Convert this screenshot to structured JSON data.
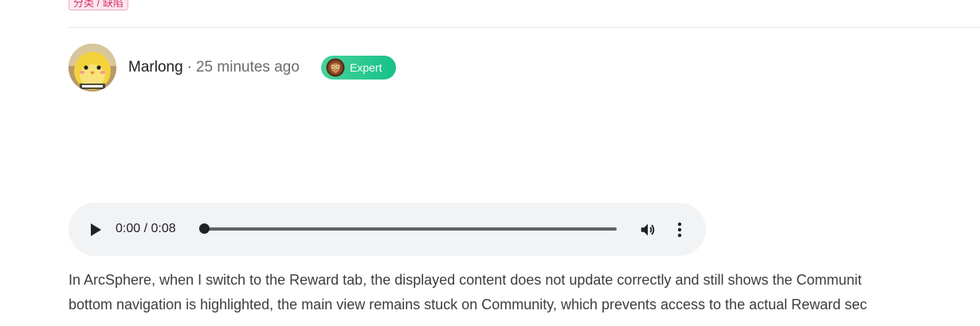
{
  "post": {
    "tag_label": "分类 / 缺陷",
    "author": {
      "name": "Marlong",
      "separator": "·",
      "time": "25 minutes ago",
      "badge": "Expert"
    },
    "audio": {
      "time": "0:00 / 0:08",
      "progress": 0
    },
    "body_lines": [
      "In ArcSphere, when I switch to the Reward tab, the displayed content does not update correctly and still shows the Communit",
      "bottom navigation is highlighted, the main view remains stuck on Community, which prevents access to the actual Reward sec"
    ]
  },
  "colors": {
    "badge_green": "#1cc58c",
    "tag_pink": "#d6336c",
    "audio_bg": "#f1f3f4"
  },
  "icons": {
    "avatar": "yellow-chick-avatar",
    "badge": "owl-emblem-icon",
    "play": "play-icon",
    "volume": "volume-icon",
    "more": "more-vertical-icon"
  }
}
